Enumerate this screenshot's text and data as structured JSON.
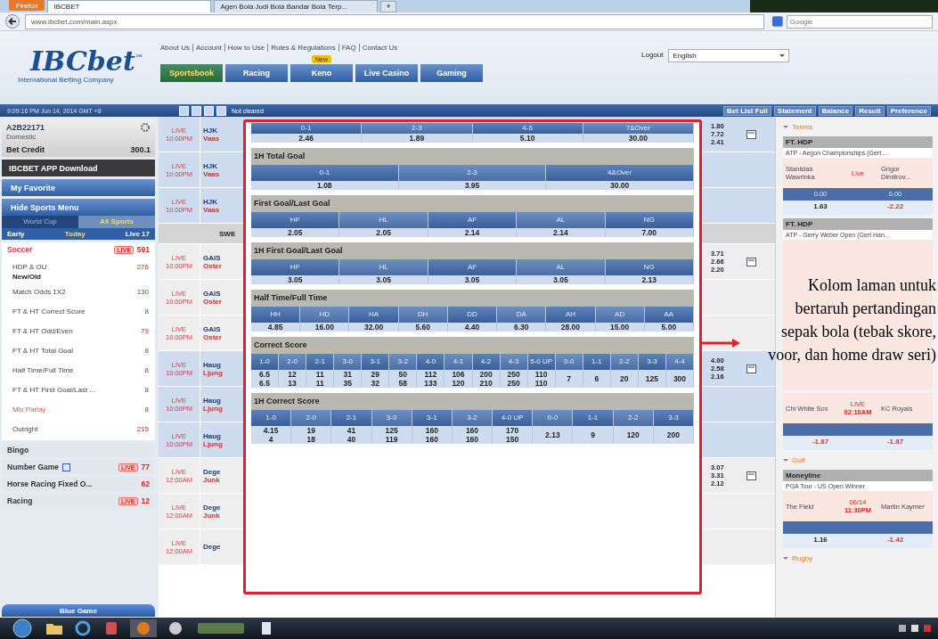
{
  "browser": {
    "menu_button": "Firefox",
    "tabs": [
      {
        "label": "IBCBET",
        "selected": true
      },
      {
        "label": "Agen Bola Judi Bola Bandar Bola Terp...",
        "selected": false
      }
    ],
    "new_tab": "+",
    "address": "www.ibcbet.com/main.aspx",
    "search_placeholder": "Google"
  },
  "header": {
    "logo": "IBCbet",
    "logo_mark": "™",
    "tagline": "International Betting Company",
    "top_links": [
      "About Us",
      "Account",
      "How to Use",
      "Rules & Regulations",
      "FAQ",
      "Contact Us"
    ],
    "logout": "Logout",
    "language": "English",
    "nav": [
      {
        "label": "Sportsbook",
        "selected": true
      },
      {
        "label": "Racing",
        "selected": false
      },
      {
        "label": "Keno",
        "selected": false,
        "badge": "New"
      },
      {
        "label": "Live Casino",
        "selected": false
      },
      {
        "label": "Gaming",
        "selected": false
      }
    ]
  },
  "toolbar": {
    "datetime": "9:09:16 PM Jun 14, 2014 GMT +8",
    "status": "Not cleared",
    "links": [
      "Bet List Full",
      "Statement",
      "Balance",
      "Result",
      "Preference"
    ]
  },
  "sidebar": {
    "account": "A2B22171",
    "account_type": "Domestic",
    "credit_label": "Bet Credit",
    "credit": "300.1",
    "app_button": "IBCBET APP Download",
    "favorite": "My Favorite",
    "menu_toggle": "Hide Sports Menu",
    "groups": [
      {
        "label": "World Cup",
        "selected": false
      },
      {
        "label": "All Sports",
        "selected": true
      }
    ],
    "periods": [
      {
        "label": "Early",
        "selected": false
      },
      {
        "label": "Today",
        "selected": true
      },
      {
        "label": "Live 17",
        "selected": false
      }
    ],
    "categories": [
      {
        "name": "Soccer",
        "expanded": true,
        "live": "LIVE",
        "count": "591",
        "info_icon": false,
        "items": [
          {
            "label": "HDP & OU",
            "count": "276",
            "highlight": false
          },
          {
            "label": "New/Old",
            "highlight": false
          },
          {
            "label": "Match Odds 1X2",
            "count": "130",
            "highlight": false
          },
          {
            "label": "FT & HT Correct Score",
            "count": "8",
            "highlight": false
          },
          {
            "label": "FT & HT Odd/Even",
            "count": "79",
            "highlight": false
          },
          {
            "label": "FT & HT Total Goal",
            "count": "8",
            "highlight": false
          },
          {
            "label": "Half Time/Full Time",
            "count": "8",
            "highlight": false
          },
          {
            "label": "FT & HT First Goal/Last ...",
            "count": "8",
            "highlight": false
          },
          {
            "label": "Mix Parlay",
            "count": "8",
            "highlight": true
          },
          {
            "label": "Outright",
            "count": "215",
            "highlight": false
          }
        ]
      },
      {
        "name": "Bingo",
        "expanded": false,
        "info_icon": false
      },
      {
        "name": "Number Game",
        "expanded": false,
        "live": "LIVE",
        "count": "77",
        "info_icon": true
      },
      {
        "name": "Horse Racing Fixed O...",
        "expanded": false,
        "count": "62",
        "info_icon": false
      },
      {
        "name": "Racing",
        "expanded": false,
        "live": "LIVE",
        "count": "12",
        "info_icon": false
      }
    ],
    "bottom_button": "Blue Game"
  },
  "matches": [
    {
      "kind": "match",
      "status": "LIVE",
      "time": "10:00PM",
      "home": "HJK",
      "away": "Vaas",
      "highlight": true,
      "odds": [
        "1.80",
        "7.72",
        "2.41"
      ]
    },
    {
      "kind": "match",
      "status": "LIVE",
      "time": "10:00PM",
      "home": "HJK",
      "away": "Vaas",
      "highlight": true
    },
    {
      "kind": "match",
      "status": "LIVE",
      "time": "10:00PM",
      "home": "HJK",
      "away": "Vaas",
      "highlight": true
    },
    {
      "kind": "league",
      "title": "SWE"
    },
    {
      "kind": "match",
      "status": "LIVE",
      "time": "10:00PM",
      "home": "GAIS",
      "away": "Oster",
      "highlight": false,
      "odds": [
        "3.71",
        "2.66",
        "2.20"
      ]
    },
    {
      "kind": "match",
      "status": "LIVE",
      "time": "10:00PM",
      "home": "GAIS",
      "away": "Oster",
      "highlight": false
    },
    {
      "kind": "match",
      "status": "LIVE",
      "time": "10:00PM",
      "home": "GAIS",
      "away": "Oster",
      "highlight": false
    },
    {
      "kind": "match",
      "status": "LIVE",
      "time": "10:00PM",
      "home": "Haug",
      "away": "Ljung",
      "highlight": true,
      "odds": [
        "4.00",
        "2.58",
        "2.16"
      ]
    },
    {
      "kind": "match",
      "status": "LIVE",
      "time": "10:00PM",
      "home": "Haug",
      "away": "Ljung",
      "highlight": true
    },
    {
      "kind": "match",
      "status": "LIVE",
      "time": "10:00PM",
      "home": "Haug",
      "away": "Ljung",
      "highlight": true
    },
    {
      "kind": "match",
      "status": "LIVE",
      "time": "12:00AM",
      "home": "Dege",
      "away": "Junk",
      "highlight": false,
      "odds": [
        "3.07",
        "3.31",
        "2.12"
      ]
    },
    {
      "kind": "match",
      "status": "LIVE",
      "time": "12:00AM",
      "home": "Dege",
      "away": "Junk",
      "highlight": false
    },
    {
      "kind": "match",
      "status": "LIVE",
      "time": "12:00AM",
      "home": "Dege",
      "highlight": false
    }
  ],
  "markets": [
    {
      "columns": [
        {
          "label": "0-1",
          "values": [
            "2.46"
          ]
        },
        {
          "label": "2-3",
          "values": [
            "1.89"
          ]
        },
        {
          "label": "4-6",
          "values": [
            "5.10"
          ]
        },
        {
          "label": "7&Over",
          "values": [
            "30.00"
          ]
        }
      ]
    },
    {
      "title": "1H Total Goal",
      "columns": [
        {
          "label": "0-1",
          "values": [
            "1.08"
          ]
        },
        {
          "label": "2-3",
          "values": [
            "3.95"
          ]
        },
        {
          "label": "4&Over",
          "values": [
            "30.00"
          ]
        }
      ]
    },
    {
      "title": "First Goal/Last Goal",
      "columns": [
        {
          "label": "HF",
          "values": [
            "2.05"
          ]
        },
        {
          "label": "HL",
          "values": [
            "2.05"
          ]
        },
        {
          "label": "AF",
          "values": [
            "2.14"
          ]
        },
        {
          "label": "AL",
          "values": [
            "2.14"
          ]
        },
        {
          "label": "NG",
          "values": [
            "7.00"
          ]
        }
      ]
    },
    {
      "title": "1H First Goal/Last Goal",
      "columns": [
        {
          "label": "HF",
          "values": [
            "3.05"
          ]
        },
        {
          "label": "HL",
          "values": [
            "3.05"
          ]
        },
        {
          "label": "AF",
          "values": [
            "3.05"
          ]
        },
        {
          "label": "AL",
          "values": [
            "3.05"
          ]
        },
        {
          "label": "NG",
          "values": [
            "2.13"
          ]
        }
      ]
    },
    {
      "title": "Half Time/Full Time",
      "columns": [
        {
          "label": "HH",
          "values": [
            "4.85"
          ]
        },
        {
          "label": "HD",
          "values": [
            "16.00"
          ]
        },
        {
          "label": "HA",
          "values": [
            "32.00"
          ]
        },
        {
          "label": "DH",
          "values": [
            "5.60"
          ]
        },
        {
          "label": "DD",
          "values": [
            "4.40"
          ]
        },
        {
          "label": "DA",
          "values": [
            "6.30"
          ]
        },
        {
          "label": "AH",
          "values": [
            "28.00"
          ]
        },
        {
          "label": "AD",
          "values": [
            "15.00"
          ]
        },
        {
          "label": "AA",
          "values": [
            "5.00"
          ]
        }
      ]
    },
    {
      "title": "Correct Score",
      "columns": [
        {
          "label": "1-0",
          "values": [
            "6.5",
            "6.5"
          ]
        },
        {
          "label": "2-0",
          "values": [
            "12",
            "13"
          ]
        },
        {
          "label": "2-1",
          "values": [
            "11",
            "11"
          ]
        },
        {
          "label": "3-0",
          "values": [
            "31",
            "35"
          ]
        },
        {
          "label": "3-1",
          "values": [
            "29",
            "32"
          ]
        },
        {
          "label": "3-2",
          "values": [
            "50",
            "58"
          ]
        },
        {
          "label": "4-0",
          "values": [
            "112",
            "133"
          ]
        },
        {
          "label": "4-1",
          "values": [
            "106",
            "120"
          ]
        },
        {
          "label": "4-2",
          "values": [
            "200",
            "210"
          ]
        },
        {
          "label": "4-3",
          "values": [
            "250",
            "250"
          ]
        },
        {
          "label": "5-0 UP",
          "values": [
            "110",
            "110"
          ]
        },
        {
          "label": "0-0",
          "values": [
            "7"
          ]
        },
        {
          "label": "1-1",
          "values": [
            "6"
          ]
        },
        {
          "label": "2-2",
          "values": [
            "20"
          ]
        },
        {
          "label": "3-3",
          "values": [
            "125"
          ]
        },
        {
          "label": "4-4",
          "values": [
            "300"
          ]
        }
      ]
    },
    {
      "title": "1H Correct Score",
      "columns": [
        {
          "label": "1-0",
          "values": [
            "4.15",
            "4"
          ]
        },
        {
          "label": "2-0",
          "values": [
            "19",
            "18"
          ]
        },
        {
          "label": "2-1",
          "values": [
            "41",
            "40"
          ]
        },
        {
          "label": "3-0",
          "values": [
            "125",
            "119"
          ]
        },
        {
          "label": "3-1",
          "values": [
            "160",
            "160"
          ]
        },
        {
          "label": "3-2",
          "values": [
            "160",
            "160"
          ]
        },
        {
          "label": "4-0 UP",
          "values": [
            "170",
            "150"
          ]
        },
        {
          "label": "0-0",
          "values": [
            "2.13"
          ]
        },
        {
          "label": "1-1",
          "values": [
            "9"
          ]
        },
        {
          "label": "2-2",
          "values": [
            "120"
          ]
        },
        {
          "label": "3-3",
          "values": [
            "200"
          ]
        }
      ]
    }
  ],
  "right_panel": [
    {
      "name": "Tennis",
      "cards": [
        {
          "market": "FT. HDP",
          "league": "ATP - Aegon Championships (Gert ...",
          "home": "Stanislas Wawrinka",
          "status": "Live",
          "away": "Grigor Dimitrov...",
          "lines": [
            "0.00",
            "0.00"
          ],
          "prices": [
            "1.63",
            "-2.22"
          ]
        },
        {
          "market": "FT. HDP",
          "league": "ATP - Gerry Weber Open (Gert Han..."
        }
      ]
    },
    {
      "cards": [
        {
          "home": "Chi White Sox",
          "status": "LIVE",
          "time": "02:10AM",
          "away": "KC Royals",
          "prices": [
            "-1.87",
            "-1.87"
          ]
        }
      ]
    },
    {
      "name": "Golf",
      "cards": [
        {
          "market": "Moneyline",
          "league": "PGA Tour - US Open Winner",
          "home": "The Field",
          "status": "06/14",
          "time": "11:30PM",
          "away": "Martin Kaymer",
          "prices": [
            "1.16",
            "-1.42"
          ]
        }
      ]
    },
    {
      "name": "Rugby"
    }
  ],
  "annotation": "Kolom laman untuk bertaruh pertandingan sepak bola (tebak skore, voor, dan home draw seri)"
}
